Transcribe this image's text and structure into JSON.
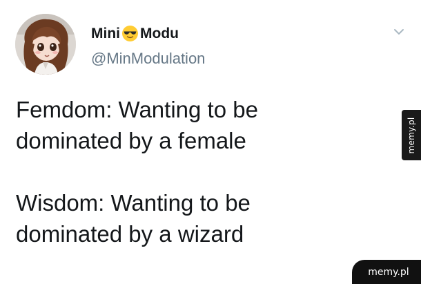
{
  "tweet": {
    "author": {
      "name_part1": "Mini",
      "name_emoji": "smiling-face-with-sunglasses",
      "name_part2": "Modu",
      "handle": "@MinModulation",
      "avatar_icon": "anime-avatar"
    },
    "menu_icon": "chevron-down-icon",
    "paragraphs": [
      "Femdom: Wanting to be\ndominated by a female",
      "Wisdom: Wanting to be\ndominated by a wizard"
    ]
  },
  "watermarks": {
    "side": "memy.pl",
    "corner": "memy.pl"
  },
  "colors": {
    "text": "#14171a",
    "secondary": "#657786",
    "watermark_bg": "#111111"
  }
}
